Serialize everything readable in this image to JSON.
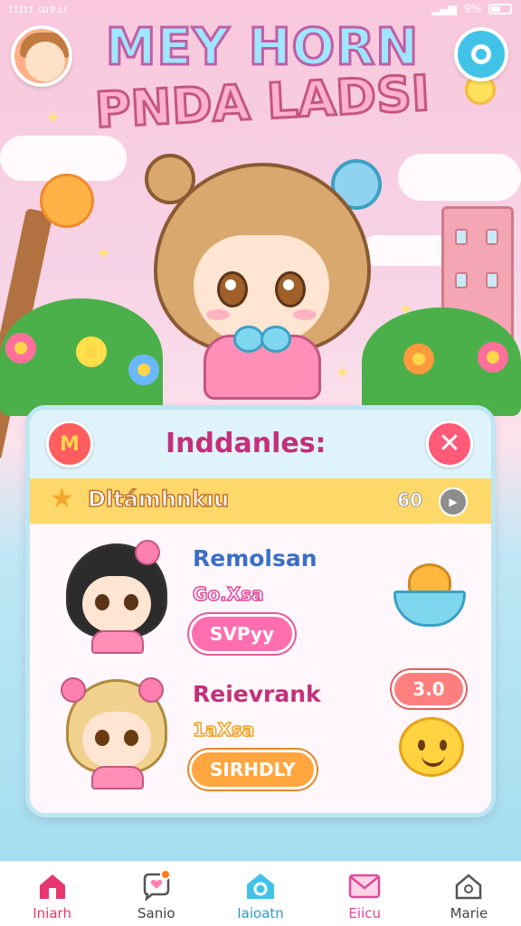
{
  "status_bar": {
    "left_text": "ɪɪɪɪɪ ɯɐɹɹ",
    "battery_text": "9%"
  },
  "header": {
    "title_line1": "MEY HORN",
    "title_line2": "PNDA LADSI"
  },
  "panel": {
    "title": "Inddanles:",
    "currency": {
      "label": "Dltámhnkıu",
      "value": "60"
    },
    "items": [
      {
        "name": "Remolsan",
        "subtitle": "Go.Xsa",
        "button": "SVPyy",
        "name_color": "#3b6fc6",
        "sub_color": "#e0489a"
      },
      {
        "name": "Reievrank",
        "subtitle": "1aXsa",
        "button": "SIRHDLY",
        "price": "3.0",
        "name_color": "#c2307a",
        "sub_color": "#f0a020"
      }
    ]
  },
  "nav": [
    {
      "label": "Iniarh",
      "icon": "home-icon",
      "color": "#e8366e"
    },
    {
      "label": "Sanio",
      "icon": "chat-heart-icon",
      "color": "#444444"
    },
    {
      "label": "Iaioatn",
      "icon": "home-ring-icon",
      "color": "#2d9cc7"
    },
    {
      "label": "Eiicu",
      "icon": "mail-icon",
      "color": "#e0489a"
    },
    {
      "label": "Marie",
      "icon": "house-outline-icon",
      "color": "#444444"
    }
  ]
}
